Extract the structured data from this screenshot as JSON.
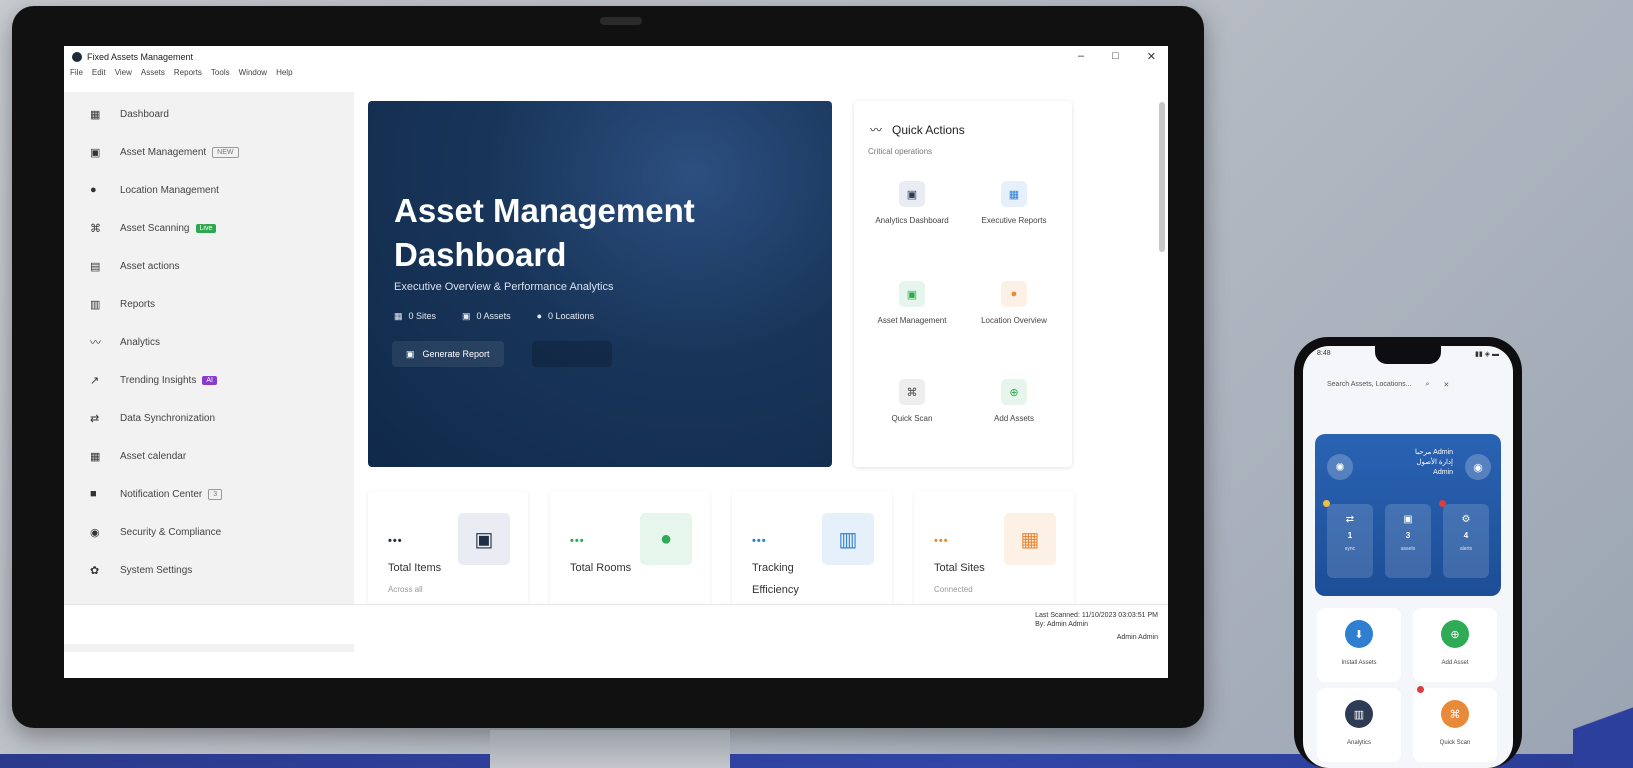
{
  "window": {
    "title": "Fixed Assets Management",
    "controls": [
      "–",
      "□",
      "✕"
    ]
  },
  "menu": [
    "File",
    "Edit",
    "View",
    "Assets",
    "Reports",
    "Tools",
    "Window",
    "Help"
  ],
  "sidebar": {
    "items": [
      {
        "icon": "grid-icon",
        "glyph": "▦",
        "label": "Dashboard"
      },
      {
        "icon": "box-icon",
        "glyph": "▣",
        "label": "Asset Management",
        "badge": "NEW"
      },
      {
        "icon": "pin-icon",
        "glyph": "●",
        "label": "Location Management"
      },
      {
        "icon": "scan-icon",
        "glyph": "⌘",
        "label": "Asset Scanning",
        "badge": "Live"
      },
      {
        "icon": "doc-icon",
        "glyph": "▤",
        "label": "Asset actions"
      },
      {
        "icon": "report-icon",
        "glyph": "▥",
        "label": "Reports"
      },
      {
        "icon": "trend-icon",
        "glyph": "〰",
        "label": "Analytics"
      },
      {
        "icon": "trending-icon",
        "glyph": "↗",
        "label": "Trending Insights",
        "badge": "AI"
      },
      {
        "icon": "sync-icon",
        "glyph": "⇄",
        "label": "Data Synchronization"
      },
      {
        "icon": "calendar-icon",
        "glyph": "▦",
        "label": "Asset calendar"
      },
      {
        "icon": "bell-icon",
        "glyph": "■",
        "label": "Notification Center",
        "badge": "3"
      },
      {
        "icon": "shield-icon",
        "glyph": "◉",
        "label": "Security & Compliance"
      },
      {
        "icon": "gear-icon",
        "glyph": "✿",
        "label": "System Settings"
      }
    ]
  },
  "hero": {
    "title_line1": "Asset Management",
    "title_line2": "Dashboard",
    "subtitle": "Executive Overview & Performance Analytics",
    "stats": [
      {
        "icon": "building-icon",
        "glyph": "▦",
        "text": "0 Sites"
      },
      {
        "icon": "box-icon",
        "glyph": "▣",
        "text": "0 Assets"
      },
      {
        "icon": "pin-icon",
        "glyph": "●",
        "text": "0 Locations"
      }
    ],
    "report_button": "Generate Report"
  },
  "quick_actions": {
    "title": "Quick Actions",
    "subtitle": "Critical operations",
    "items": [
      {
        "label": "Analytics Dashboard",
        "glyph": "▣",
        "color": "#2d3b55",
        "bg": "#e9edf3"
      },
      {
        "label": "Executive Reports",
        "glyph": "▦",
        "color": "#2f7fd1",
        "bg": "#e6f0fb"
      },
      {
        "label": "Asset Management",
        "glyph": "▣",
        "color": "#2faa55",
        "bg": "#e7f6ec"
      },
      {
        "label": "Location Overview",
        "glyph": "●",
        "color": "#e98a3a",
        "bg": "#fdf0e4"
      },
      {
        "label": "Quick Scan",
        "glyph": "⌘",
        "color": "#444444",
        "bg": "#eeeeee"
      },
      {
        "label": "Add Assets",
        "glyph": "⊕",
        "color": "#2faa55",
        "bg": "#e7f6ec"
      }
    ]
  },
  "cards": [
    {
      "dots": "•••",
      "label": "Total Items",
      "sub": "Across all",
      "glyph": "▣",
      "color": "#1f2e45",
      "bg": "#e9edf3",
      "dotColor": "#1f2e45"
    },
    {
      "dots": "•••",
      "label": "Total Rooms",
      "sub": "",
      "glyph": "●",
      "color": "#2faa55",
      "bg": "#e7f6ec",
      "dotColor": "#2faa55"
    },
    {
      "dots": "•••",
      "label": "Tracking Efficiency",
      "sub": "",
      "glyph": "▥",
      "color": "#2f7fd1",
      "bg": "#e6f0fb",
      "dotColor": "#2f7fd1"
    },
    {
      "dots": "•••",
      "label": "Total Sites",
      "sub": "Connected",
      "glyph": "▦",
      "color": "#e98a3a",
      "bg": "#fdf0e4",
      "dotColor": "#e98a3a"
    }
  ],
  "footer": {
    "line1": "Last Scanned: 11/10/2023 03:03:51 PM",
    "line2": "By: Admin Admin",
    "line3": "Admin Admin"
  },
  "phone": {
    "status_left": "8:48",
    "status_right": "▮▮ ◈ ▬",
    "search_placeholder": "Search Assets, Locations...",
    "hero_line1": "مرحبا Admin",
    "hero_line2": "إدارة الأصول",
    "hero_line3": "Admin",
    "stats": [
      {
        "glyph": "⇄",
        "value": "1",
        "label": "sync",
        "dot": "#f2c230"
      },
      {
        "glyph": "▣",
        "value": "3",
        "label": "assets",
        "dot": ""
      },
      {
        "glyph": "⚙",
        "value": "4",
        "label": "alerts",
        "dot": "#e23b3b"
      }
    ],
    "tiles": [
      {
        "label": "Install Assets",
        "glyph": "⬇",
        "color": "#2f7fd1"
      },
      {
        "label": "Add Asset",
        "glyph": "⊕",
        "color": "#2faa55"
      },
      {
        "label": "Analytics",
        "glyph": "▥",
        "color": "#2d3b55"
      },
      {
        "label": "Quick Scan",
        "glyph": "⌘",
        "color": "#e98a3a"
      }
    ]
  }
}
